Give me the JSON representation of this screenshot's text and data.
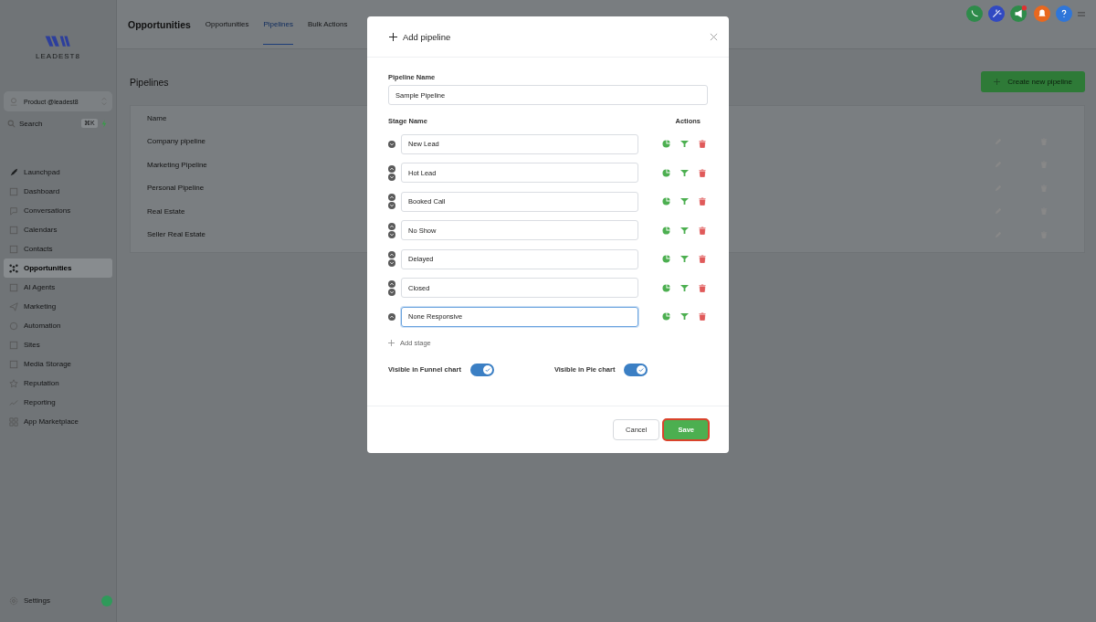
{
  "brand": {
    "name": "LEADEST8"
  },
  "account": {
    "name": "Product @leadest8"
  },
  "search": {
    "placeholder": "Search",
    "shortcut": "⌘K"
  },
  "sidebar": {
    "items": [
      {
        "label": "Launchpad",
        "selected": false
      },
      {
        "label": "Dashboard",
        "selected": false
      },
      {
        "label": "Conversations",
        "selected": false
      },
      {
        "label": "Calendars",
        "selected": false
      },
      {
        "label": "Contacts",
        "selected": false
      },
      {
        "label": "Opportunities",
        "selected": true
      },
      {
        "label": "AI Agents",
        "selected": false
      },
      {
        "label": "Marketing",
        "selected": false
      },
      {
        "label": "Automation",
        "selected": false
      },
      {
        "label": "Sites",
        "selected": false
      },
      {
        "label": "Media Storage",
        "selected": false
      },
      {
        "label": "Reputation",
        "selected": false
      },
      {
        "label": "Reporting",
        "selected": false
      },
      {
        "label": "App Marketplace",
        "selected": false
      }
    ],
    "footer": {
      "label": "Settings"
    }
  },
  "header": {
    "title": "Opportunities",
    "tabs": [
      {
        "label": "Opportunities",
        "selected": false
      },
      {
        "label": "Pipelines",
        "selected": true
      },
      {
        "label": "Bulk Actions",
        "selected": false
      }
    ]
  },
  "page": {
    "title": "Pipelines",
    "create_button": "Create new pipeline"
  },
  "table": {
    "columns": [
      "Name"
    ],
    "rows": [
      {
        "name": "Company pipeline"
      },
      {
        "name": "Marketing Pipeline"
      },
      {
        "name": "Personal Pipeline"
      },
      {
        "name": "Real Estate"
      },
      {
        "name": "Seller Real Estate"
      }
    ]
  },
  "modal": {
    "title": "Add pipeline",
    "pipeline_name_label": "Pipeline Name",
    "pipeline_name": "Sample Pipeline",
    "stage_label": "Stage Name",
    "actions_label": "Actions",
    "stages": [
      {
        "name": "New Lead",
        "can_move_up": false,
        "can_move_down": true,
        "focused": false
      },
      {
        "name": "Hot Lead",
        "can_move_up": true,
        "can_move_down": true,
        "focused": false
      },
      {
        "name": "Booked Call",
        "can_move_up": true,
        "can_move_down": true,
        "focused": false
      },
      {
        "name": "No Show",
        "can_move_up": true,
        "can_move_down": true,
        "focused": false
      },
      {
        "name": "Delayed",
        "can_move_up": true,
        "can_move_down": true,
        "focused": false
      },
      {
        "name": "Closed",
        "can_move_up": true,
        "can_move_down": true,
        "focused": false
      },
      {
        "name": "None Responsive",
        "can_move_up": true,
        "can_move_down": false,
        "focused": true
      }
    ],
    "add_stage": "Add stage",
    "toggles": [
      {
        "label": "Visible in Funnel chart",
        "on": true
      },
      {
        "label": "Visible in Pie chart",
        "on": true
      }
    ],
    "cancel": "Cancel",
    "save": "Save"
  }
}
